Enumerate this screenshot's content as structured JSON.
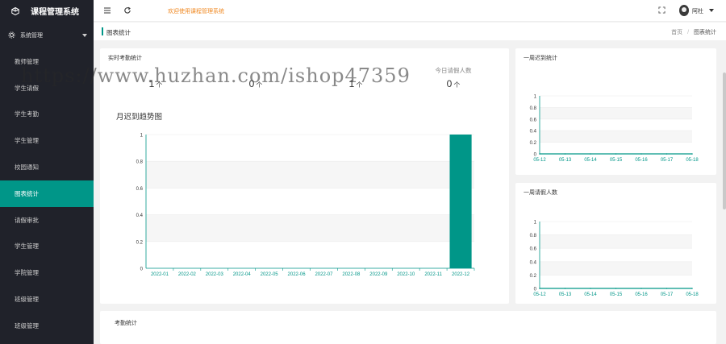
{
  "app": {
    "title": "课程管理系统"
  },
  "sidebar": {
    "group_label": "系统管理",
    "items": [
      {
        "label": "教师管理",
        "active": false
      },
      {
        "label": "学生请假",
        "active": false
      },
      {
        "label": "学生考勤",
        "active": false
      },
      {
        "label": "学生管理",
        "active": false
      },
      {
        "label": "校园通知",
        "active": false
      },
      {
        "label": "图表统计",
        "active": true
      },
      {
        "label": "请假审批",
        "active": false
      },
      {
        "label": "学生管理",
        "active": false
      },
      {
        "label": "学院管理",
        "active": false
      },
      {
        "label": "班级管理",
        "active": false
      },
      {
        "label": "班级管理",
        "active": false
      }
    ]
  },
  "topbar": {
    "welcome": "欢迎使用课程管理系统",
    "username": "阿杜"
  },
  "page": {
    "title": "图表统计",
    "breadcrumb_home": "首页",
    "breadcrumb_sep": "/",
    "breadcrumb_current": "图表统计"
  },
  "stats_card": {
    "title": "实时考勤统计",
    "items": [
      {
        "label": "",
        "value": "1",
        "unit": "个"
      },
      {
        "label": "",
        "value": "0",
        "unit": "个"
      },
      {
        "label": "",
        "value": "1",
        "unit": "个"
      },
      {
        "label": "今日请假人数",
        "value": "0",
        "unit": "个"
      }
    ],
    "chart_title": "月迟到趋势图"
  },
  "week_late_card": {
    "title": "一周迟到统计"
  },
  "week_leave_card": {
    "title": "一周请假人数"
  },
  "bottom_card": {
    "title": "考勤统计"
  },
  "watermark": "https://www.huzhan.com/ishop47359",
  "colors": {
    "accent": "#009688",
    "sidebar": "#20222a",
    "welcome": "#f08a24"
  },
  "chart_data": [
    {
      "type": "bar",
      "title": "",
      "categories": [
        "2022-01",
        "2022-02",
        "2022-03",
        "2022-04",
        "2022-05",
        "2022-06",
        "2022-07",
        "2022-08",
        "2022-09",
        "2022-10",
        "2022-11",
        "2022-12"
      ],
      "values": [
        0,
        0,
        0,
        0,
        0,
        0,
        0,
        0,
        0,
        0,
        0,
        1
      ],
      "ylim": [
        0,
        1
      ],
      "yticks": [
        "0",
        "0.2",
        "0.4",
        "0.6",
        "0.8",
        "1"
      ],
      "grid": true
    },
    {
      "type": "line",
      "title": "",
      "categories": [
        "05-12",
        "05-13",
        "05-14",
        "05-15",
        "05-16",
        "05-17",
        "05-18"
      ],
      "values": [
        0,
        0,
        0,
        0,
        0,
        0,
        0
      ],
      "ylim": [
        0,
        1
      ],
      "yticks": [
        "0",
        "0.2",
        "0.4",
        "0.6",
        "0.8",
        "1"
      ],
      "grid": true
    },
    {
      "type": "line",
      "title": "",
      "categories": [
        "05-12",
        "05-13",
        "05-14",
        "05-15",
        "05-16",
        "05-17",
        "05-18"
      ],
      "values": [
        0,
        0,
        0,
        0,
        0,
        0,
        0
      ],
      "ylim": [
        0,
        1
      ],
      "yticks": [
        "0",
        "0.2",
        "0.4",
        "0.6",
        "0.8",
        "1"
      ],
      "grid": true
    }
  ]
}
